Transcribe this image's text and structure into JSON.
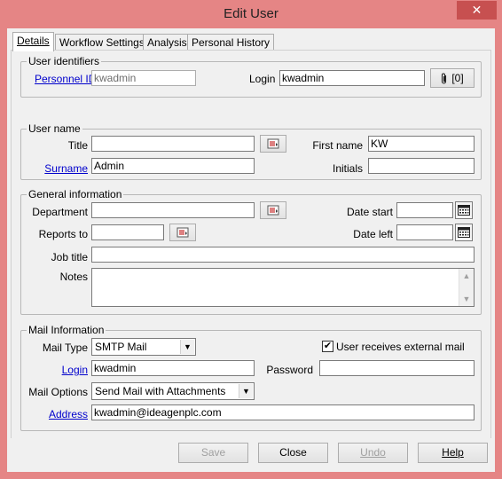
{
  "window": {
    "title": "Edit User",
    "close_glyph": "✕"
  },
  "tabs": [
    {
      "label": "Details",
      "active": true
    },
    {
      "label": "Workflow Settings"
    },
    {
      "label": "Analysis"
    },
    {
      "label": "Personal History"
    }
  ],
  "identifiers": {
    "legend": "User identifiers",
    "personnel_id_label": "Personnel ID",
    "personnel_id_value": "kwadmin",
    "login_label": "Login",
    "login_value": "kwadmin",
    "attachments_count": "[0]"
  },
  "user_name": {
    "legend": "User name",
    "title_label": "Title",
    "title_value": "",
    "first_name_label": "First name",
    "first_name_value": "KW",
    "surname_label": "Surname",
    "surname_value": "Admin",
    "initials_label": "Initials",
    "initials_value": ""
  },
  "general": {
    "legend": "General information",
    "department_label": "Department",
    "department_value": "",
    "date_start_label": "Date start",
    "date_start_value": "",
    "reports_to_label": "Reports to",
    "reports_to_value": "",
    "date_left_label": "Date left",
    "date_left_value": "",
    "job_title_label": "Job title",
    "job_title_value": "",
    "notes_label": "Notes",
    "notes_value": ""
  },
  "mail": {
    "legend": "Mail Information",
    "mail_type_label": "Mail Type",
    "mail_type_value": "SMTP Mail",
    "external_mail_label": "User receives external mail",
    "external_mail_checked": true,
    "login_label": "Login",
    "login_value": "kwadmin",
    "password_label": "Password",
    "password_value": "",
    "mail_options_label": "Mail Options",
    "mail_options_value": "Send Mail with Attachments",
    "address_label": "Address",
    "address_value": "kwadmin@ideagenplc.com"
  },
  "buttons": {
    "save": "Save",
    "close": "Close",
    "undo": "Undo",
    "help": "Help"
  },
  "colors": {
    "window_frame": "#e58585",
    "close_button": "#c75050",
    "link": "#0000cc"
  }
}
